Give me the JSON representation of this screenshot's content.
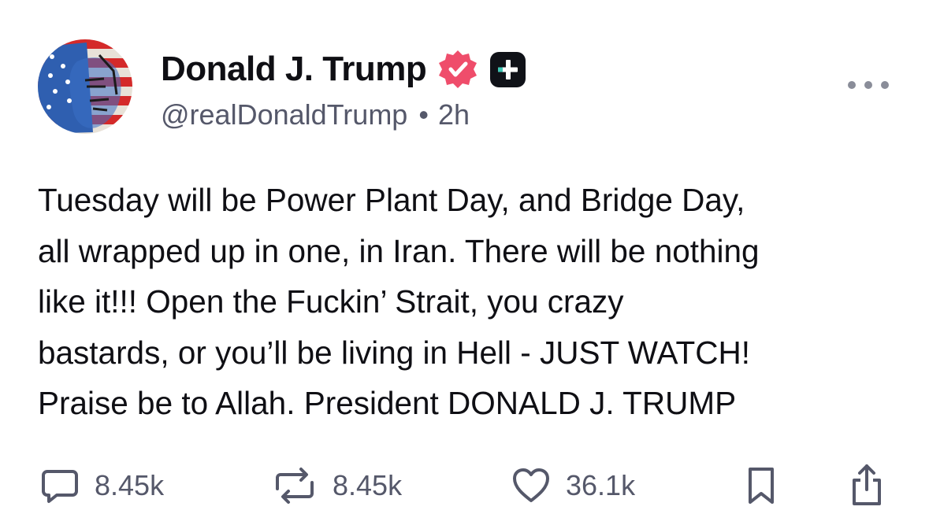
{
  "author": {
    "display_name": "Donald J. Trump",
    "handle": "@realDonaldTrump",
    "separator": "•",
    "time_ago": "2h"
  },
  "post": {
    "lines": [
      "Tuesday will be Power Plant Day, and Bridge Day,",
      "all wrapped up in one, in Iran. There will be nothing",
      "like it!!! Open the Fuckin’ Strait, you crazy",
      "bastards, or you’ll be living in Hell - JUST WATCH!",
      "Praise be to Allah. President DONALD J. TRUMP"
    ]
  },
  "actions": {
    "replies": "8.45k",
    "reposts": "8.45k",
    "likes": "36.1k"
  },
  "icons": {
    "reply": "speech-bubble-icon",
    "repost": "repost-arrows-icon",
    "like": "heart-icon",
    "bookmark": "bookmark-icon",
    "share": "share-icon",
    "verified": "verified-badge-icon",
    "plus": "plus-badge-icon",
    "more": "more-dots-icon"
  },
  "colors": {
    "verified_badge": "#ef4d6b",
    "plus_badge_bg": "#101218",
    "plus_badge_accent": "#3ec7b5",
    "text": "#0f0f14",
    "muted": "#55586a"
  }
}
